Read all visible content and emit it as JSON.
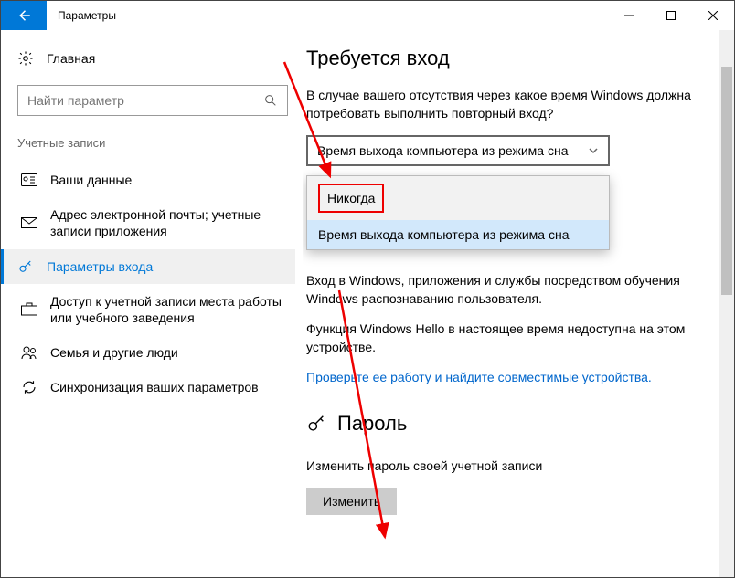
{
  "window": {
    "title": "Параметры"
  },
  "sidebar": {
    "home": "Главная",
    "search_placeholder": "Найти параметр",
    "section": "Учетные записи",
    "items": [
      {
        "label": "Ваши данные"
      },
      {
        "label": "Адрес электронной почты; учетные записи приложения"
      },
      {
        "label": "Параметры входа"
      },
      {
        "label": "Доступ к учетной записи места работы или учебного заведения"
      },
      {
        "label": "Семья и другие люди"
      },
      {
        "label": "Синхронизация ваших параметров"
      }
    ]
  },
  "content": {
    "heading1": "Требуется вход",
    "para1": "В случае вашего отсутствия через какое время Windows должна потребовать выполнить повторный вход?",
    "dropdown_selected": "Время выхода компьютера из режима сна",
    "dropdown_options": {
      "opt1": "Никогда",
      "opt2": "Время выхода компьютера из режима сна"
    },
    "para2": "Вход в Windows, приложения и службы посредством обучения Windows распознаванию пользователя.",
    "para3": "Функция Windows Hello в настоящее время недоступна на этом устройстве.",
    "link": "Проверьте ее работу и найдите совместимые устройства.",
    "heading2": "Пароль",
    "para4": "Изменить пароль своей учетной записи",
    "change_btn": "Изменить"
  }
}
